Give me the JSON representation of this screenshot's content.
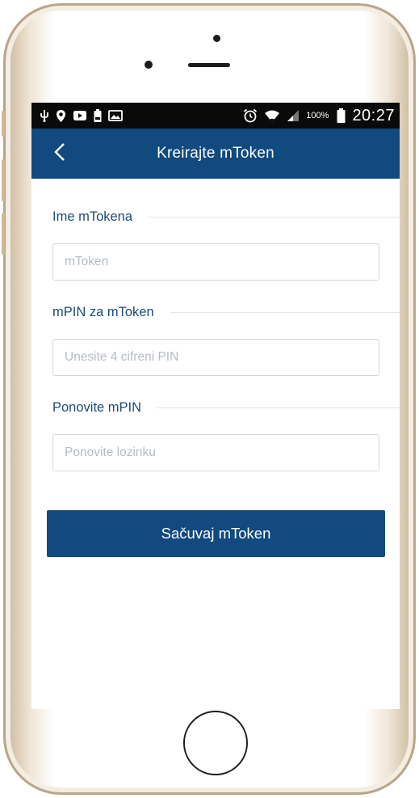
{
  "status_bar": {
    "left_icons": [
      "usb-icon",
      "location-icon",
      "video-icon",
      "battery-saver-icon",
      "image-icon"
    ],
    "right_icons": [
      "alarm-icon",
      "wifi-icon",
      "signal-icon",
      "battery-icon"
    ],
    "battery_percent": "100%",
    "time": "20:27"
  },
  "app_bar": {
    "back_icon": "chevron-left-icon",
    "title": "Kreirajte mToken"
  },
  "form": {
    "token_name": {
      "label": "Ime mTokena",
      "value": "",
      "placeholder": "mToken"
    },
    "mpin": {
      "label": "mPIN za mToken",
      "value": "",
      "placeholder": "Unesite 4 cifreni PIN"
    },
    "mpin_repeat": {
      "label": "Ponovite mPIN",
      "value": "",
      "placeholder": "Ponovite lozinku"
    },
    "save_label": "Sačuvaj mToken"
  },
  "colors": {
    "primary": "#104a7f",
    "label": "#1c4a7a",
    "status_bar": "#0a0a0a"
  }
}
